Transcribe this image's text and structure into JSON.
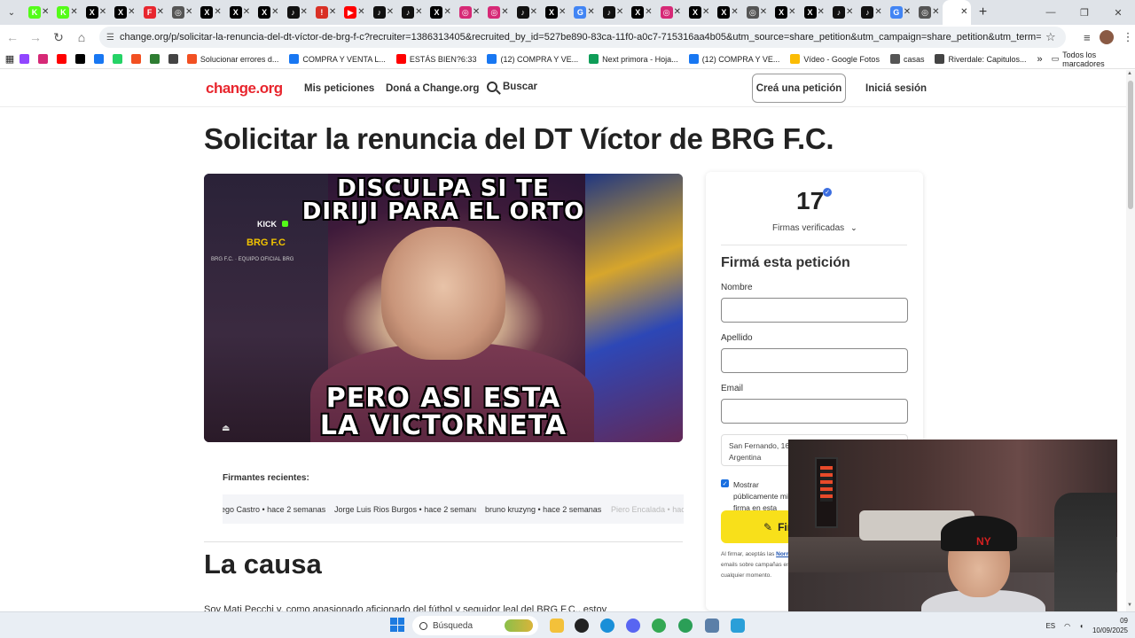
{
  "browser": {
    "tabs": [
      {
        "icon": "kick-icon",
        "color": "#53fc18",
        "glyph": "K"
      },
      {
        "icon": "kick-icon",
        "color": "#53fc18",
        "glyph": "K"
      },
      {
        "icon": "x-icon",
        "color": "#000000",
        "glyph": "X"
      },
      {
        "icon": "x-icon",
        "color": "#000000",
        "glyph": "X"
      },
      {
        "icon": "f-icon",
        "color": "#e8262e",
        "glyph": "F"
      },
      {
        "icon": "tab-icon",
        "color": "#555555",
        "glyph": "◎"
      },
      {
        "icon": "x-icon",
        "color": "#000000",
        "glyph": "X"
      },
      {
        "icon": "x-icon",
        "color": "#000000",
        "glyph": "X"
      },
      {
        "icon": "x-icon",
        "color": "#000000",
        "glyph": "X"
      },
      {
        "icon": "tiktok-icon",
        "color": "#111111",
        "glyph": "♪"
      },
      {
        "icon": "alert-icon",
        "color": "#d93025",
        "glyph": "!"
      },
      {
        "icon": "youtube-icon",
        "color": "#ff0000",
        "glyph": "▶"
      },
      {
        "icon": "tiktok-icon",
        "color": "#111111",
        "glyph": "♪"
      },
      {
        "icon": "tiktok-icon",
        "color": "#111111",
        "glyph": "♪"
      },
      {
        "icon": "x-icon",
        "color": "#000000",
        "glyph": "X"
      },
      {
        "icon": "instagram-icon",
        "color": "#d62976",
        "glyph": "◎"
      },
      {
        "icon": "instagram-icon",
        "color": "#d62976",
        "glyph": "◎"
      },
      {
        "icon": "tiktok-icon",
        "color": "#111111",
        "glyph": "♪"
      },
      {
        "icon": "x-icon",
        "color": "#000000",
        "glyph": "X"
      },
      {
        "icon": "google-icon",
        "color": "#4285f4",
        "glyph": "G"
      },
      {
        "icon": "tiktok-icon",
        "color": "#111111",
        "glyph": "♪"
      },
      {
        "icon": "x-icon",
        "color": "#000000",
        "glyph": "X"
      },
      {
        "icon": "instagram-icon",
        "color": "#d62976",
        "glyph": "◎"
      },
      {
        "icon": "x-icon",
        "color": "#000000",
        "glyph": "X"
      },
      {
        "icon": "x-icon",
        "color": "#000000",
        "glyph": "X"
      },
      {
        "icon": "tab-icon",
        "color": "#555555",
        "glyph": "◎"
      },
      {
        "icon": "x-icon",
        "color": "#000000",
        "glyph": "X"
      },
      {
        "icon": "x-icon",
        "color": "#000000",
        "glyph": "X"
      },
      {
        "icon": "tiktok-icon",
        "color": "#111111",
        "glyph": "♪"
      },
      {
        "icon": "tiktok-icon",
        "color": "#111111",
        "glyph": "♪"
      },
      {
        "icon": "google-icon",
        "color": "#4285f4",
        "glyph": "G"
      },
      {
        "icon": "tab-icon",
        "color": "#555555",
        "glyph": "◎"
      }
    ],
    "url": "change.org/p/solicitar-la-renuncia-del-dt-víctor-de-brg-f-c?recruiter=1386313405&recruited_by_id=527be890-83ca-11f0-a0c7-715316aa4b05&utm_source=share_petition&utm_campaign=share_petition&utm_term=starter_onboarding_share_persona...",
    "bookmarks": [
      {
        "label": "",
        "icon": "twitch-icon",
        "color": "#9146ff"
      },
      {
        "label": "",
        "icon": "instagram-icon",
        "color": "#d62976"
      },
      {
        "label": "",
        "icon": "youtube-icon",
        "color": "#ff0000"
      },
      {
        "label": "",
        "icon": "x-icon",
        "color": "#000000"
      },
      {
        "label": "",
        "icon": "facebook-icon",
        "color": "#1877f2"
      },
      {
        "label": "",
        "icon": "whatsapp-icon",
        "color": "#25d366"
      },
      {
        "label": "",
        "icon": "windows-icon",
        "color": "#f25022"
      },
      {
        "label": "",
        "icon": "bookmark-icon",
        "color": "#2e7d32"
      },
      {
        "label": "",
        "icon": "globe-icon",
        "color": "#444444"
      },
      {
        "label": "Solucionar errores d...",
        "icon": "windows-icon",
        "color": "#f25022"
      },
      {
        "label": "COMPRA Y VENTA L...",
        "icon": "facebook-icon",
        "color": "#1877f2"
      },
      {
        "label": "ESTÁS BIEN?6:33",
        "icon": "youtube-icon",
        "color": "#ff0000"
      },
      {
        "label": "(12) COMPRA Y VE...",
        "icon": "facebook-icon",
        "color": "#1877f2"
      },
      {
        "label": "Next primora - Hoja...",
        "icon": "sheets-icon",
        "color": "#0f9d58"
      },
      {
        "label": "(12) COMPRA Y VE...",
        "icon": "facebook-icon",
        "color": "#1877f2"
      },
      {
        "label": "Vídeo - Google Fotos",
        "icon": "photos-icon",
        "color": "#fbbc04"
      },
      {
        "label": "casas",
        "icon": "folder-icon",
        "color": "#555555"
      },
      {
        "label": "Riverdale: Capitulos...",
        "icon": "globe-icon",
        "color": "#444444"
      }
    ],
    "bookmarks_more": "»",
    "all_bookmarks": "Todos los marcadores"
  },
  "site": {
    "logo": "change.org",
    "nav": {
      "my_petitions": "Mis peticiones",
      "donate": "Doná a Change.org",
      "search": "Buscar",
      "create": "Creá una petición",
      "login": "Iniciá sesión"
    },
    "accent": "#e8262e"
  },
  "petition": {
    "title": "Solicitar la renuncia del DT Víctor de BRG F.C.",
    "image": {
      "top_text_1": "DISCULPA SI TE",
      "top_text_2": "DIRIJI PARA EL ORTO",
      "bottom_text_1": "PERO ASI ESTA",
      "bottom_text_2": "LA VICTORNETA",
      "brand": "BRG F.C",
      "kick": "KICK",
      "subtitle": "BRG F.C. · EQUIPO OFICIAL BRG"
    },
    "recent_signers_label": "Firmantes recientes:",
    "recent_signers": [
      {
        "text": "ego Castro • hace 2 semanas"
      },
      {
        "text": "Jorge Luis Rios Burgos • hace 2 semanas"
      },
      {
        "text": "bruno kruzyng • hace 2 semanas"
      },
      {
        "text": "Piero Encalada • hace"
      }
    ],
    "cause_heading": "La causa",
    "cause_text": "Soy Mati Pecchi y, como apasionado aficionado del fútbol y seguidor leal del BRG F.C., estoy"
  },
  "sign_card": {
    "count": "17",
    "verified_label": "Firmas verificadas",
    "heading": "Firmá esta petición",
    "fields": {
      "first_name": "Nombre",
      "last_name": "Apellido",
      "email": "Email"
    },
    "location_line1": "San Fernando, 164",
    "location_line2": "Argentina",
    "public_label": "Mostrar públicamente mi firma en esta petición",
    "public_checked": true,
    "sign_button": "Firmar",
    "terms_prefix": "Al firmar, aceptás las",
    "terms_link": "Normas",
    "terms_rest": "Change.org y también aceptás recibir emails sobre campañas en Change.org. Podés darte de baja en cualquier momento.",
    "button_color": "#f8e01a"
  },
  "taskbar": {
    "search_placeholder": "Búsqueda",
    "lang": "ES",
    "time": "09",
    "date": "10/09/2025"
  }
}
